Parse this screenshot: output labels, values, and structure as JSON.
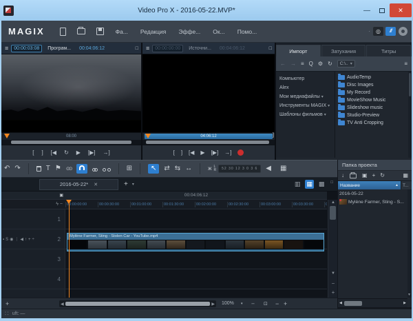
{
  "window": {
    "title": "Video Pro X - 2016-05-22.MVP*",
    "minimize": "—",
    "close": "✕"
  },
  "menubar": {
    "logo": "MAGIX",
    "menus": [
      "Фа...",
      "Редакция",
      "Эффе...",
      "Ок...",
      "Помо..."
    ],
    "dot": "·",
    "cd_label": "◎",
    "brush_label": "///"
  },
  "monitors": {
    "program": {
      "current": "00:00:03:08",
      "label": "Програм...",
      "total": "00:04:06:12",
      "scrub_label": "08:00"
    },
    "source": {
      "current": "00:00:00:00",
      "label": "Источни...",
      "total": "00:04:06:12",
      "scrub_label": "04:06:12",
      "end_bracket": "]"
    }
  },
  "transport": {
    "set_in": "[",
    "set_out": "]",
    "to_start": "[◀",
    "loop": "↻",
    "play": "▶",
    "play_range": "[▶]",
    "to_end": "→]"
  },
  "pool": {
    "tabs": [
      "Импорт",
      "Затухания",
      "Титры"
    ],
    "path": "C:\\..",
    "tree": [
      "Компьютер",
      "Alex",
      "Мои медиафайлы",
      "Инструменты MAGIX",
      "Шаблоны фильмов"
    ],
    "folders": [
      "AudioTemp",
      "Disc Images",
      "My Record",
      "MovieShow Music",
      "Slideshow music",
      "Studio-Preview",
      "TV Anti Cropping"
    ]
  },
  "toolbar": {
    "meter_scale": "52 30 12  3 0 3 6",
    "left_ch": "L",
    "right_ch": "R"
  },
  "project": {
    "title": "Папка проекта",
    "col_name": "Название",
    "col_type": "Т...",
    "rows": [
      "2016-05-22",
      "Mylène Farmer, Sting - S..."
    ]
  },
  "timeline": {
    "tab": "2016-05-22*",
    "timecode": "00:04:06:12",
    "ruler": [
      "00:00:00:00",
      "00:00:30:00",
      "00:01:00:00",
      "00:01:30:00",
      "00:02:00:00",
      "00:02:30:00",
      "00:03:00:00",
      "00:03:30:00",
      "00"
    ],
    "tracks": [
      "1",
      "2",
      "3",
      "4"
    ],
    "track_icons": "▪S◉⋮◀↑+÷",
    "clip_title": "Mylène Farmer, Sting - Stolen Car - YouTube.mp4"
  },
  "zoom": {
    "value": "100%"
  },
  "status": {
    "text": "uft: —"
  },
  "icons": {
    "menu": "≡",
    "detach": "□",
    "back": "←",
    "forward": "→",
    "tree": "≡",
    "search": "Q",
    "settings": "⚙",
    "refresh": "↻",
    "caret": "▾",
    "list": "≡",
    "undo": "↶",
    "redo": "↷",
    "text": "T",
    "marker": "⚑",
    "optimize": "⊙⊙",
    "mouse": "↖",
    "mouse_obj": "⇄",
    "mouse_exch": "⇆",
    "stretch": "↔",
    "fader": "ж",
    "speaker": "◀",
    "mixer": "▦",
    "insert": "⊞",
    "view_scene": "▥",
    "view_timeline": "▦",
    "view_storyboard": "▩",
    "import": "↓",
    "save": "▣",
    "new_tab": "+",
    "up": "▲",
    "down": "▼",
    "left": "◀",
    "right": "▶",
    "minus": "−",
    "plus": "+",
    "sort": "▲",
    "lightning": "ϟ",
    "range": "▣",
    "grid_dots": "∷",
    "fit": "⊡",
    "close_tab": "✕"
  },
  "colors": {
    "accent": "#2e7fd0",
    "playhead": "#f5871f",
    "folder_icon": "#3f86d2",
    "record": "#cc2e2e",
    "titlebar": "#a6d1f2",
    "close_button": "#d14836"
  }
}
